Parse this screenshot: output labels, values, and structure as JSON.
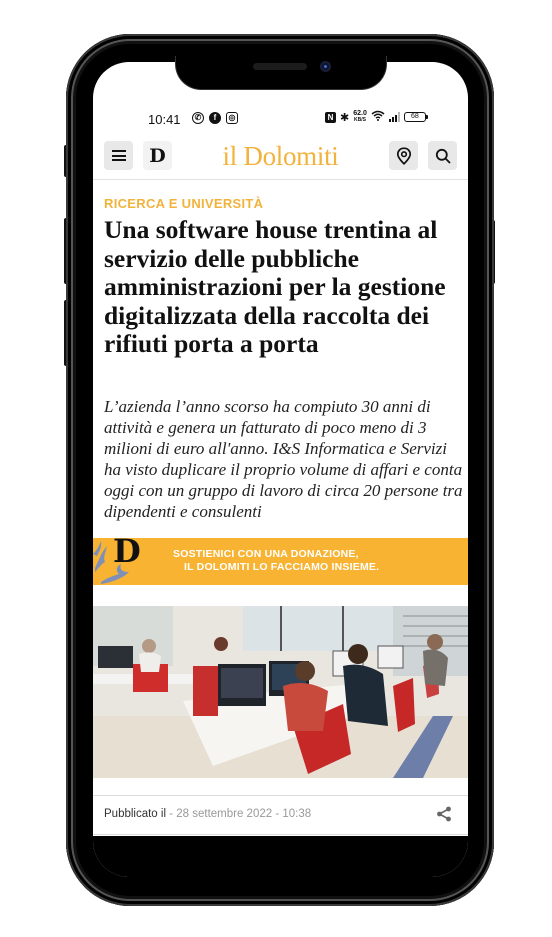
{
  "status_bar": {
    "time": "10:41",
    "app_icons": [
      "whatsapp-icon",
      "facebook-icon",
      "instagram-icon"
    ],
    "net_speed": "62.0",
    "net_unit": "KB/S",
    "battery": "68"
  },
  "header": {
    "brand": "il Dolomiti",
    "d_logo": "D",
    "menu_icon": "hamburger-menu-icon",
    "location_icon": "map-pin-icon",
    "search_icon": "search-icon"
  },
  "article": {
    "category": "RICERCA E UNIVERSITÀ",
    "headline": "Una software house trentina al servizio delle pubbliche amministrazioni per la gestione digitalizzata della raccolta dei rifiuti porta a porta",
    "summary": "L’azienda l’anno scorso ha compiuto 30 anni di attività e genera un fatturato di poco meno di 3 milioni di euro all'anno. I&S Informatica e Servizi ha visto duplicare il proprio volume di affari e conta oggi con un gruppo di lavoro di circa 20 persone tra dipendenti e consulenti",
    "photo_alt": "Office with developers working at computers and red chairs",
    "published_label": "Pubblicato il",
    "published_date": "- 28 settembre 2022 - 10:38"
  },
  "banner": {
    "line1": "SOSTIENICI CON UNA DONAZIONE,",
    "line2": "IL DOLOMITI LO FACCIAMO INSIEME.",
    "logo": "D"
  },
  "colors": {
    "brand": "#f2b33d",
    "banner_bg": "#f8b333"
  }
}
